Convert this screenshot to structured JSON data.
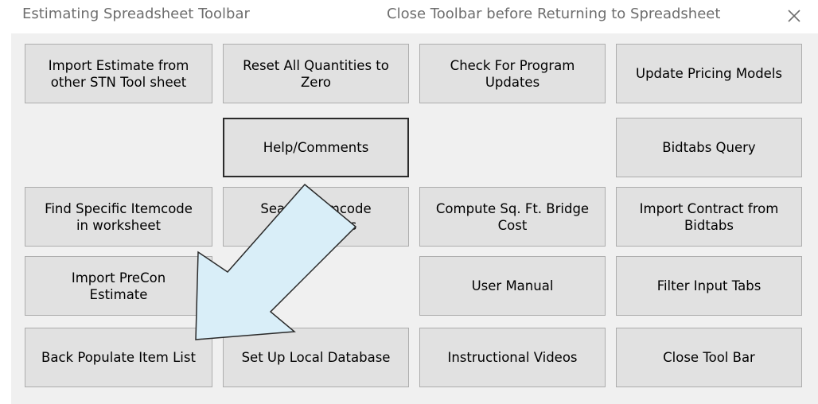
{
  "window": {
    "title": "Estimating Spreadsheet Toolbar",
    "instruction": "Close Toolbar before Returning to Spreadsheet",
    "close_icon": "close-icon"
  },
  "buttons": {
    "import_estimate": "Import Estimate from\nother STN Tool sheet",
    "reset_quantities": "Reset All Quantities to\nZero",
    "check_updates": "Check For Program\nUpdates",
    "update_pricing": "Update Pricing Models",
    "help_comments": "Help/Comments",
    "bidtabs_query": "Bidtabs Query",
    "find_itemcode": "Find Specific Itemcode\nin worksheet",
    "search_itemcode": "Search Itemcode\nDescriptions",
    "compute_bridge": "Compute Sq. Ft. Bridge\nCost",
    "import_contract": "Import Contract from\nBidtabs",
    "import_precon": "Import PreCon\nEstimate",
    "user_manual": "User Manual",
    "filter_tabs": "Filter Input Tabs",
    "back_populate": "Back Populate Item List",
    "local_database": "Set Up Local Database",
    "videos": "Instructional Videos",
    "close_toolbar": "Close Tool Bar"
  },
  "annotation": {
    "arrow_icon": "arrow-pointer-icon",
    "arrow_fill": "#d9eef8",
    "arrow_stroke": "#2a2a2a"
  }
}
